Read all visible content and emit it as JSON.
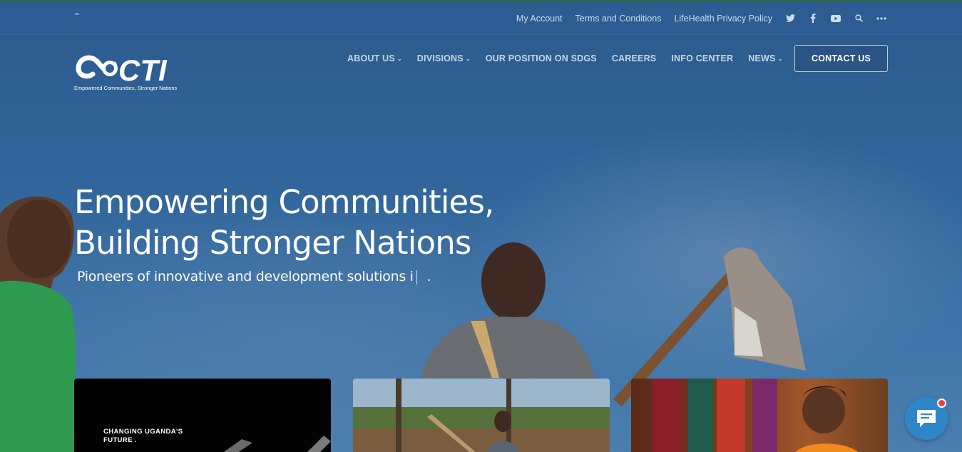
{
  "topbar": {
    "trademark": "™",
    "links": [
      "My Account",
      "Terms and Conditions",
      "LifeHealth Privacy Policy"
    ],
    "icons": [
      "twitter-icon",
      "facebook-icon",
      "youtube-icon",
      "search-icon",
      "more-icon"
    ]
  },
  "logo": {
    "wordmark": "CTI",
    "tagline": "Empowered Communities, Stronger Nations"
  },
  "nav": {
    "items": [
      {
        "label": "ABOUT US",
        "dropdown": true
      },
      {
        "label": "DIVISIONS",
        "dropdown": true
      },
      {
        "label": "OUR POSITION ON SDGS",
        "dropdown": false
      },
      {
        "label": "CAREERS",
        "dropdown": false
      },
      {
        "label": "INFO CENTER",
        "dropdown": false
      },
      {
        "label": "NEWS",
        "dropdown": true
      }
    ],
    "contact_label": "CONTACT US"
  },
  "hero": {
    "title_line1": "Empowering Communities,",
    "title_line2": "Building Stronger Nations",
    "subtitle": "Pioneers of innovative and development solutions i",
    "subtitle_end": "."
  },
  "cards": [
    {
      "text_line1": "CHANGING UGANDA'S",
      "text_line2": "FUTURE ."
    },
    {},
    {}
  ],
  "colors": {
    "topbar": "#2e5c94",
    "sky": "#32679c",
    "chat_button": "#2f86c7",
    "notification_dot": "#e2443b"
  }
}
